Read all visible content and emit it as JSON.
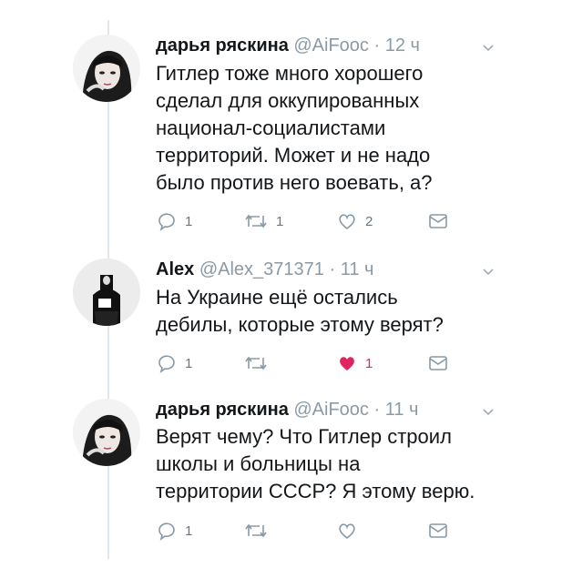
{
  "tweets": [
    {
      "name": "дарья ряскина",
      "handle": "@AiFooc",
      "separator": "·",
      "time": "12 ч",
      "text_lines": [
        "Гитлер тоже много хорошего",
        "сделал для оккупированных",
        "национал-социалистами",
        "территорий. Может и не надо",
        "было против него воевать, а?"
      ],
      "reply_count": "1",
      "retweet_count": "1",
      "like_count": "2",
      "liked": false
    },
    {
      "name": "Alex",
      "handle": "@Alex_371371",
      "separator": "·",
      "time": "11 ч",
      "text_lines": [
        "На Украине ещё остались",
        "дебилы, которые этому верят?"
      ],
      "reply_count": "1",
      "retweet_count": "",
      "like_count": "1",
      "liked": true
    },
    {
      "name": "дарья ряскина",
      "handle": "@AiFooc",
      "separator": "·",
      "time": "11 ч",
      "text_lines": [
        "Верят чему? Что Гитлер строил",
        "школы и больницы на",
        "территории СССР? Я этому верю."
      ],
      "reply_count": "1",
      "retweet_count": "",
      "like_count": "",
      "liked": false
    }
  ],
  "icons": {
    "reply": "reply-icon",
    "retweet": "retweet-icon",
    "like": "heart-icon",
    "dm": "envelope-icon",
    "caret": "chevron-down-icon"
  },
  "colors": {
    "icon_gray": "#8899a6",
    "like_red": "#e0245e",
    "handle_gray": "#8a9aa6",
    "thread_line": "#e1e8ed"
  }
}
